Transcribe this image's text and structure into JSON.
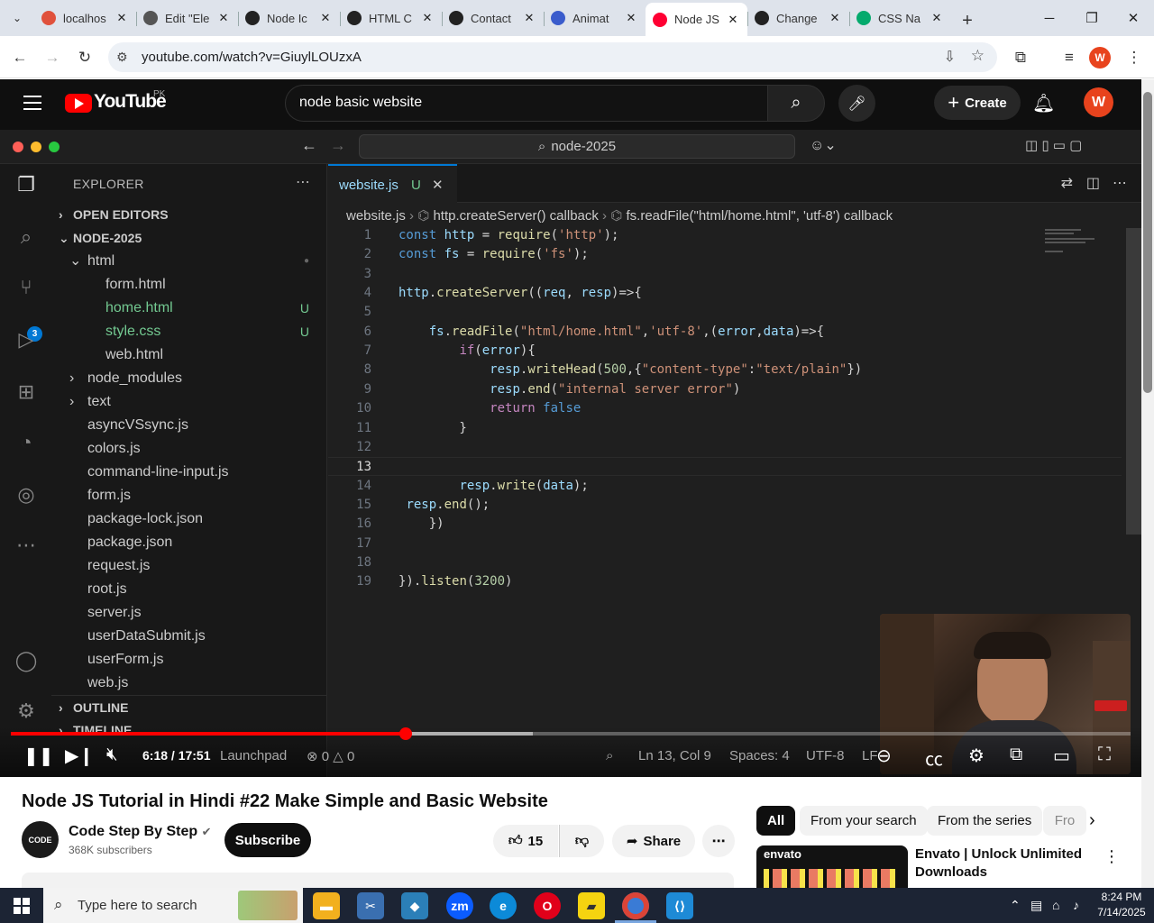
{
  "browser": {
    "tabs": [
      {
        "title": "localhos",
        "icon": "xampp-icon",
        "color": "#e0513c"
      },
      {
        "title": "Edit \"Ele",
        "icon": "globe-icon",
        "color": "#555"
      },
      {
        "title": "Node Ic",
        "icon": "chatgpt-icon",
        "color": "#222"
      },
      {
        "title": "HTML C",
        "icon": "chatgpt-icon",
        "color": "#222"
      },
      {
        "title": "Contact",
        "icon": "chatgpt-icon",
        "color": "#222"
      },
      {
        "title": "Animat",
        "icon": "animation-icon",
        "color": "#3a5ccc"
      },
      {
        "title": "Node JS",
        "icon": "youtube-icon",
        "color": "#ff0033"
      },
      {
        "title": "Change",
        "icon": "chatgpt-icon",
        "color": "#222"
      },
      {
        "title": "CSS Na",
        "icon": "w3schools-icon",
        "color": "#04aa6d"
      }
    ],
    "active_tab": 6,
    "url": "youtube.com/watch?v=GiuylLOUzxA",
    "profile_initial": "W"
  },
  "youtube": {
    "country": "PK",
    "logo_text": "YouTube",
    "search_value": "node basic website",
    "create_label": "Create",
    "avatar_initial": "W"
  },
  "vscode": {
    "search_label": "node-2025",
    "explorer_title": "EXPLORER",
    "open_editors": "OPEN EDITORS",
    "folder": "NODE-2025",
    "scm_badge": "3",
    "tree": [
      {
        "name": "html",
        "type": "folder-open",
        "indent": 1,
        "status": "dot"
      },
      {
        "name": "form.html",
        "type": "file",
        "indent": 2,
        "status": ""
      },
      {
        "name": "home.html",
        "type": "file-mod",
        "indent": 2,
        "status": "U"
      },
      {
        "name": "style.css",
        "type": "file-mod",
        "indent": 2,
        "status": "U"
      },
      {
        "name": "web.html",
        "type": "file",
        "indent": 2,
        "status": ""
      },
      {
        "name": "node_modules",
        "type": "folder",
        "indent": 1,
        "status": ""
      },
      {
        "name": "text",
        "type": "folder",
        "indent": 1,
        "status": ""
      },
      {
        "name": "asyncVSsync.js",
        "type": "file",
        "indent": 1,
        "status": ""
      },
      {
        "name": "colors.js",
        "type": "file",
        "indent": 1,
        "status": ""
      },
      {
        "name": "command-line-input.js",
        "type": "file",
        "indent": 1,
        "status": ""
      },
      {
        "name": "form.js",
        "type": "file",
        "indent": 1,
        "status": ""
      },
      {
        "name": "package-lock.json",
        "type": "file",
        "indent": 1,
        "status": ""
      },
      {
        "name": "package.json",
        "type": "file",
        "indent": 1,
        "status": ""
      },
      {
        "name": "request.js",
        "type": "file",
        "indent": 1,
        "status": ""
      },
      {
        "name": "root.js",
        "type": "file",
        "indent": 1,
        "status": ""
      },
      {
        "name": "server.js",
        "type": "file",
        "indent": 1,
        "status": ""
      },
      {
        "name": "userDataSubmit.js",
        "type": "file",
        "indent": 1,
        "status": ""
      },
      {
        "name": "userForm.js",
        "type": "file",
        "indent": 1,
        "status": ""
      },
      {
        "name": "web.js",
        "type": "file",
        "indent": 1,
        "status": ""
      }
    ],
    "outline": "OUTLINE",
    "timeline": "TIMELINE",
    "tab_name": "website.js",
    "tab_status": "U",
    "breadcrumb": [
      "website.js",
      "http.createServer() callback",
      "fs.readFile(\"html/home.html\", 'utf-8') callback"
    ],
    "current_line": 13,
    "code": [
      [
        [
          "kw",
          "const "
        ],
        [
          "var",
          "http"
        ],
        [
          "pu",
          " = "
        ],
        [
          "fn",
          "require"
        ],
        [
          "pu",
          "("
        ],
        [
          "str",
          "'http'"
        ],
        [
          "pu",
          ");"
        ]
      ],
      [
        [
          "kw",
          "const "
        ],
        [
          "var",
          "fs"
        ],
        [
          "pu",
          " = "
        ],
        [
          "fn",
          "require"
        ],
        [
          "pu",
          "("
        ],
        [
          "str",
          "'fs'"
        ],
        [
          "pu",
          ");"
        ]
      ],
      [],
      [
        [
          "var",
          "http"
        ],
        [
          "pu",
          "."
        ],
        [
          "fn",
          "createServer"
        ],
        [
          "pu",
          "(("
        ],
        [
          "var",
          "req"
        ],
        [
          "pu",
          ", "
        ],
        [
          "var",
          "resp"
        ],
        [
          "pu",
          ")=>{"
        ]
      ],
      [],
      [
        [
          "pu",
          "    "
        ],
        [
          "var",
          "fs"
        ],
        [
          "pu",
          "."
        ],
        [
          "fn",
          "readFile"
        ],
        [
          "pu",
          "("
        ],
        [
          "str",
          "\"html/home.html\""
        ],
        [
          "pu",
          ","
        ],
        [
          "str",
          "'utf-8'"
        ],
        [
          "pu",
          ",("
        ],
        [
          "var",
          "error"
        ],
        [
          "pu",
          ","
        ],
        [
          "var",
          "data"
        ],
        [
          "pu",
          ")=>{"
        ]
      ],
      [
        [
          "pu",
          "        "
        ],
        [
          "ctl",
          "if"
        ],
        [
          "pu",
          "("
        ],
        [
          "var",
          "error"
        ],
        [
          "pu",
          "){"
        ]
      ],
      [
        [
          "pu",
          "            "
        ],
        [
          "var",
          "resp"
        ],
        [
          "pu",
          "."
        ],
        [
          "fn",
          "writeHead"
        ],
        [
          "pu",
          "("
        ],
        [
          "num",
          "500"
        ],
        [
          "pu",
          ",{"
        ],
        [
          "str",
          "\"content-type\""
        ],
        [
          "pu",
          ":"
        ],
        [
          "str",
          "\"text/plain\""
        ],
        [
          "pu",
          "})"
        ]
      ],
      [
        [
          "pu",
          "            "
        ],
        [
          "var",
          "resp"
        ],
        [
          "pu",
          "."
        ],
        [
          "fn",
          "end"
        ],
        [
          "pu",
          "("
        ],
        [
          "str",
          "\"internal server error\""
        ],
        [
          "pu",
          ")"
        ]
      ],
      [
        [
          "pu",
          "            "
        ],
        [
          "ctl",
          "return "
        ],
        [
          "kw",
          "false"
        ]
      ],
      [
        [
          "pu",
          "        }"
        ]
      ],
      [],
      [],
      [
        [
          "pu",
          "        "
        ],
        [
          "var",
          "resp"
        ],
        [
          "pu",
          "."
        ],
        [
          "fn",
          "write"
        ],
        [
          "pu",
          "("
        ],
        [
          "var",
          "data"
        ],
        [
          "pu",
          ");"
        ]
      ],
      [
        [
          "pu",
          " "
        ],
        [
          "var",
          "resp"
        ],
        [
          "pu",
          "."
        ],
        [
          "fn",
          "end"
        ],
        [
          "pu",
          "();"
        ]
      ],
      [
        [
          "pu",
          "    })"
        ]
      ],
      [],
      [],
      [
        [
          "pu",
          "})."
        ],
        [
          "fn",
          "listen"
        ],
        [
          "pu",
          "("
        ],
        [
          "num",
          "3200"
        ],
        [
          "pu",
          ")"
        ]
      ]
    ],
    "status": {
      "launchpad": "Launchpad",
      "errors": "0",
      "warnings": "0",
      "position": "Ln 13, Col 9",
      "spaces": "Spaces: 4",
      "encoding": "UTF-8",
      "eol": "LF"
    }
  },
  "player": {
    "current_time": "6:18",
    "duration": "17:51",
    "time_display": "6:18 / 17:51",
    "progress": 0.353,
    "buffered": 0.466
  },
  "video": {
    "title": "Node JS Tutorial in Hindi #22 Make Simple and Basic Website",
    "channel": "Code Step By Step",
    "channel_avatar_text": "CODE",
    "subscribers": "368K subscribers",
    "subscribe_label": "Subscribe",
    "likes": "15",
    "share_label": "Share"
  },
  "sidebar": {
    "chips": [
      "All",
      "From your search",
      "From the series",
      "Fro"
    ],
    "ad_title": "Envato | Unlock Unlimited Downloads",
    "ad_brand": "envato"
  },
  "taskbar": {
    "search_placeholder": "Type here to search",
    "time": "8:24 PM",
    "date": "7/14/2025"
  }
}
